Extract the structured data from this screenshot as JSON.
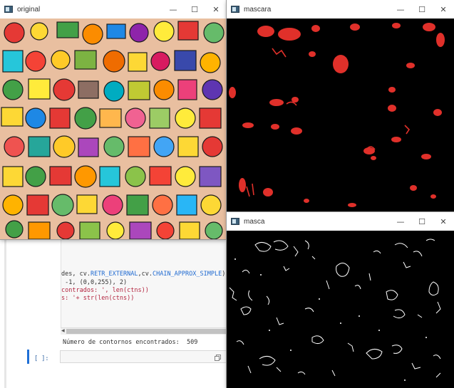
{
  "windows": {
    "original": {
      "title": "original",
      "controls": [
        "—",
        "☐",
        "✕"
      ]
    },
    "mascara": {
      "title": "mascara",
      "controls": [
        "—",
        "☐",
        "✕"
      ]
    },
    "masca": {
      "title": "masca",
      "controls": [
        "—",
        "☐",
        "✕"
      ]
    }
  },
  "notebook": {
    "code_lines": [
      {
        "parts": [
          "des, cv.",
          "RETR_EXTERNAL",
          ",cv.",
          "CHAIN_APPROX_SIMPLE",
          ")"
        ]
      },
      {
        "text": " -1, (0,0,255), 2)"
      },
      {
        "text": "contrados: ', len(ctns))"
      },
      {
        "text": "s: '+ str(len(ctns))"
      }
    ],
    "output_text": "Número de contornos encontrados:  509",
    "input_prompt": "[ ]:",
    "scroll_arrow": "◀"
  },
  "colors": {
    "titlebar": "#ffffff",
    "mask_red": "#e0302a",
    "edge_white": "#ffffff",
    "accent_blue": "#1f6fd6"
  }
}
